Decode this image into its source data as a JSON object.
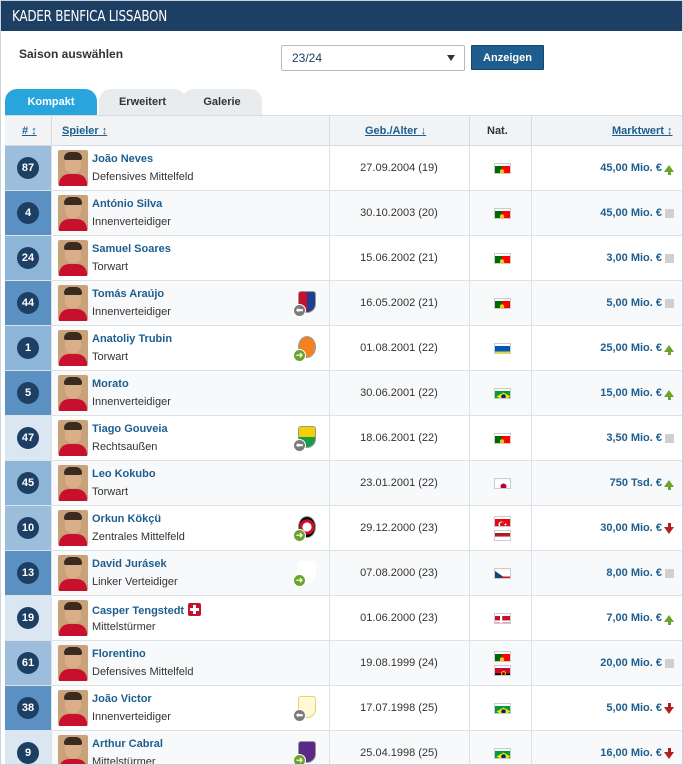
{
  "header": {
    "title": "KADER BENFICA LISSABON"
  },
  "season": {
    "label": "Saison auswählen",
    "selected": "23/24",
    "button": "Anzeigen"
  },
  "tabs": [
    {
      "label": "Kompakt"
    },
    {
      "label": "Erweitert"
    },
    {
      "label": "Galerie"
    }
  ],
  "columns": {
    "number": "#",
    "player": "Spieler",
    "birth": "Geb./Alter",
    "nat": "Nat.",
    "value": "Marktwert"
  },
  "colors": {
    "title_bar": "#1d3f63",
    "active_tab": "#29a5de",
    "link": "#1d5e8f",
    "up": "#6aa42d",
    "down": "#b0201f"
  },
  "players": [
    {
      "num": "87",
      "name": "João Neves",
      "pos": "Defensives Mittelfeld",
      "birth": "27.09.2004 (19)",
      "nat": [
        "portugal"
      ],
      "value": "45,00 Mio. €",
      "trend": "up",
      "group": "mf",
      "club": null,
      "injury": false
    },
    {
      "num": "4",
      "name": "António Silva",
      "pos": "Innenverteidiger",
      "birth": "30.10.2003 (20)",
      "nat": [
        "portugal"
      ],
      "value": "45,00 Mio. €",
      "trend": "same",
      "group": "df",
      "club": null,
      "injury": false
    },
    {
      "num": "24",
      "name": "Samuel Soares",
      "pos": "Torwart",
      "birth": "15.06.2002 (21)",
      "nat": [
        "portugal"
      ],
      "value": "3,00 Mio. €",
      "trend": "same",
      "group": "gk",
      "club": null,
      "injury": false
    },
    {
      "num": "44",
      "name": "Tomás Araújo",
      "pos": "Innenverteidiger",
      "birth": "16.05.2002 (21)",
      "nat": [
        "portugal"
      ],
      "value": "5,00 Mio. €",
      "trend": "same",
      "group": "df",
      "club": {
        "dir": "out",
        "icon": "gil-vicente-crest-icon"
      },
      "injury": false
    },
    {
      "num": "1",
      "name": "Anatoliy Trubin",
      "pos": "Torwart",
      "birth": "01.08.2001 (22)",
      "nat": [
        "ukraine"
      ],
      "value": "25,00 Mio. €",
      "trend": "up",
      "group": "gk",
      "club": {
        "dir": "in",
        "icon": "shakhtar-crest-icon"
      },
      "injury": false
    },
    {
      "num": "5",
      "name": "Morato",
      "pos": "Innenverteidiger",
      "birth": "30.06.2001 (22)",
      "nat": [
        "brazil"
      ],
      "value": "15,00 Mio. €",
      "trend": "up",
      "group": "df",
      "club": null,
      "injury": false
    },
    {
      "num": "47",
      "name": "Tiago Gouveia",
      "pos": "Rechtsaußen",
      "birth": "18.06.2001 (22)",
      "nat": [
        "portugal"
      ],
      "value": "3,50 Mio. €",
      "trend": "same",
      "group": "fw",
      "club": {
        "dir": "out",
        "icon": "estoril-crest-icon"
      },
      "injury": false
    },
    {
      "num": "45",
      "name": "Leo Kokubo",
      "pos": "Torwart",
      "birth": "23.01.2001 (22)",
      "nat": [
        "japan"
      ],
      "value": "750 Tsd. €",
      "trend": "up",
      "group": "gk",
      "club": null,
      "injury": false
    },
    {
      "num": "10",
      "name": "Orkun Kökçü",
      "pos": "Zentrales Mittelfeld",
      "birth": "29.12.2000 (23)",
      "nat": [
        "turkey",
        "netherlands"
      ],
      "value": "30,00 Mio. €",
      "trend": "down",
      "group": "mf",
      "club": {
        "dir": "in",
        "icon": "feyenoord-crest-icon"
      },
      "injury": false
    },
    {
      "num": "13",
      "name": "David Jurásek",
      "pos": "Linker Verteidiger",
      "birth": "07.08.2000 (23)",
      "nat": [
        "czech"
      ],
      "value": "8,00 Mio. €",
      "trend": "same",
      "group": "df",
      "club": {
        "dir": "in",
        "icon": "slavia-crest-icon"
      },
      "injury": false
    },
    {
      "num": "19",
      "name": "Casper Tengstedt",
      "pos": "Mittelstürmer",
      "birth": "01.06.2000 (23)",
      "nat": [
        "denmark"
      ],
      "value": "7,00 Mio. €",
      "trend": "up",
      "group": "fw",
      "club": null,
      "injury": true
    },
    {
      "num": "61",
      "name": "Florentino",
      "pos": "Defensives Mittelfeld",
      "birth": "19.08.1999 (24)",
      "nat": [
        "portugal",
        "angola"
      ],
      "value": "20,00 Mio. €",
      "trend": "same",
      "group": "mf",
      "club": null,
      "injury": false
    },
    {
      "num": "38",
      "name": "João Victor",
      "pos": "Innenverteidiger",
      "birth": "17.07.1998 (25)",
      "nat": [
        "brazil"
      ],
      "value": "5,00 Mio. €",
      "trend": "down",
      "group": "df",
      "club": {
        "dir": "out",
        "icon": "nantes-crest-icon"
      },
      "injury": false
    },
    {
      "num": "9",
      "name": "Arthur Cabral",
      "pos": "Mittelstürmer",
      "birth": "25.04.1998 (25)",
      "nat": [
        "brazil"
      ],
      "value": "16,00 Mio. €",
      "trend": "down",
      "group": "fw",
      "club": {
        "dir": "in",
        "icon": "fiorentina-crest-icon"
      },
      "injury": false
    }
  ]
}
